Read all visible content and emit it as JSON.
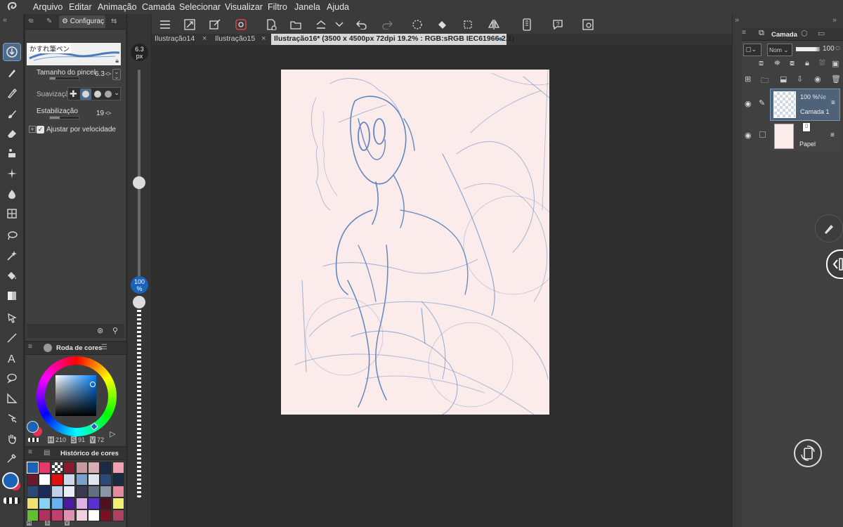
{
  "menu": [
    "Arquivo",
    "Editar",
    "Animação",
    "Camada",
    "Selecionar",
    "Visualizar",
    "Filtro",
    "Janela",
    "Ajuda"
  ],
  "subtool": {
    "tab_label": "Configuraç",
    "brush_name": "かすれ筆ペン",
    "brush_size_label": "Tamanho do pincel",
    "brush_size_value": "6.3",
    "smoothing_label": "Suavização d",
    "stabilization_label": "Estabilização",
    "stabilization_value": "19",
    "speed_label": "Ajustar por velocidade"
  },
  "color_wheel": {
    "title": "Roda de cores",
    "h_label": "H",
    "h_value": "210",
    "s_label": "S",
    "s_value": "91",
    "v_label": "V",
    "v_value": "72",
    "main_color": "#1a63b8",
    "sub_color": "#e2334e"
  },
  "history": {
    "title": "Histórico de cores",
    "swatches": [
      "#1a63b8",
      "#e23a6a",
      "checker",
      "#8a1a2e",
      "#c79aa0",
      "#d7aeb6",
      "#1b2b44",
      "#f2a0b4",
      "#6a1a2a",
      "#ffffff",
      "#e01010",
      "#cfd8e8",
      "#7aa0d0",
      "#dfe6f0",
      "#2a4a7a",
      "#1a2a40",
      "#2a4a7a",
      "#1a2a5a",
      "#c0d0e8",
      "#e8eef8",
      "#3a3a50",
      "#607080",
      "#8a96a8",
      "#e68aa0",
      "#f0e070",
      "#8ad0f0",
      "#6ab0f0",
      "#4a1aa0",
      "#e0b0e8",
      "#5a30d0",
      "#501020",
      "#f0f070",
      "#60c030",
      "#b03060",
      "#c04070",
      "#e090b0",
      "#f0d0e0",
      "#ffffff",
      "#7a1020",
      "#b04060"
    ],
    "bottom_labels": [
      "H",
      "S",
      "V"
    ]
  },
  "brush_strip": {
    "size_value": "6.3",
    "size_unit": "px",
    "opacity_value": "100",
    "opacity_unit": "%"
  },
  "tabs": [
    {
      "label": "Ilustração14"
    },
    {
      "label": "Ilustração15"
    },
    {
      "label": "Ilustração16* (3500 x 4500px 72dpi 19.2% : RGB:sRGB IEC61966-2.1)"
    }
  ],
  "layers": {
    "panel_title": "Camada",
    "blend_mode": "Nom",
    "opacity_value": "100",
    "items": [
      {
        "opacity": "100 %",
        "mode": "Ne",
        "name": "Camada 1"
      },
      {
        "name": "Papel"
      }
    ]
  },
  "colors": {
    "paper": "#fbebea",
    "sketch": "#2f66b3",
    "accent": "#4e6a8a"
  }
}
